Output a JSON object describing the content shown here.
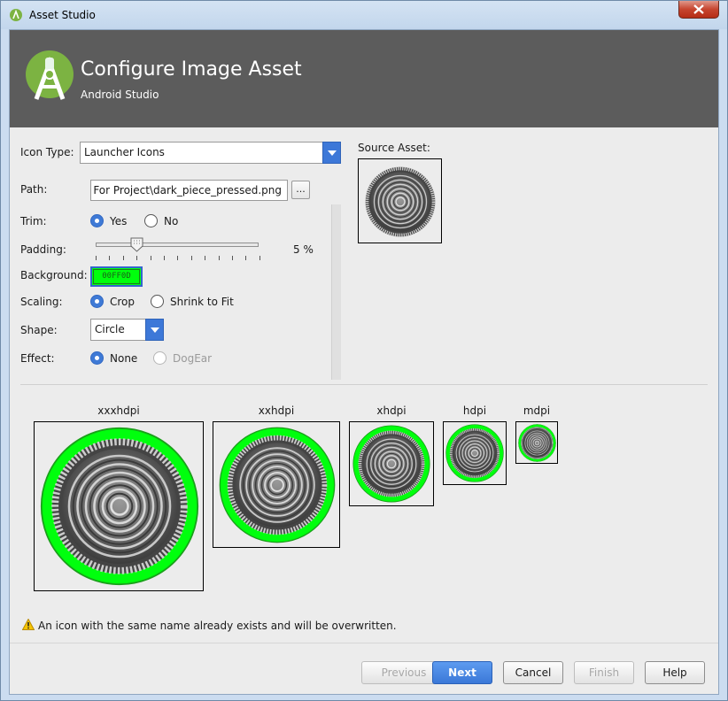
{
  "window": {
    "title": "Asset Studio"
  },
  "header": {
    "title": "Configure Image Asset",
    "subtitle": "Android Studio"
  },
  "form": {
    "icon_type_label": "Icon Type:",
    "icon_type_value": "Launcher Icons",
    "path_label": "Path:",
    "path_value": "sed For Project\\dark_piece_pressed.png",
    "browse_label": "...",
    "trim_label": "Trim:",
    "trim_options": [
      "Yes",
      "No"
    ],
    "trim_selected": "Yes",
    "padding_label": "Padding:",
    "padding_value": "5 %",
    "padding_percent": 5,
    "background_label": "Background:",
    "background_value": "00FF0D",
    "scaling_label": "Scaling:",
    "scaling_options": [
      "Crop",
      "Shrink to Fit"
    ],
    "scaling_selected": "Crop",
    "shape_label": "Shape:",
    "shape_value": "Circle",
    "effect_label": "Effect:",
    "effect_options": [
      "None",
      "DogEar"
    ],
    "effect_selected": "None"
  },
  "source": {
    "label": "Source Asset:"
  },
  "previews": [
    {
      "dpi": "xxxhdpi"
    },
    {
      "dpi": "xxhdpi"
    },
    {
      "dpi": "xhdpi"
    },
    {
      "dpi": "hdpi"
    },
    {
      "dpi": "mdpi"
    }
  ],
  "warning": {
    "icon": "warning-icon",
    "text": "An icon with the same name already exists and will be overwritten."
  },
  "buttons": {
    "previous": "Previous",
    "next": "Next",
    "cancel": "Cancel",
    "finish": "Finish",
    "help": "Help"
  },
  "colors": {
    "accent": "#3d78d8",
    "background_swatch": "#00FF0D",
    "header_bg": "#5c5c5c"
  }
}
